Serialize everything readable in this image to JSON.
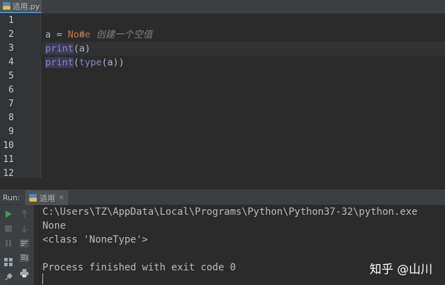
{
  "editor_tab": {
    "filename": "适用.py"
  },
  "editor": {
    "line_numbers": [
      "1",
      "2",
      "3",
      "4",
      "5",
      "6",
      "7",
      "8",
      "9",
      "10",
      "11",
      "12"
    ]
  },
  "code": {
    "line1_comment": "#  创建一个空值",
    "line2_var": "a = ",
    "line2_none": "None",
    "line3_print": "print",
    "line3_rest": "(a)",
    "line4_print": "print",
    "line4_open": "(",
    "line4_type": "type",
    "line4_rest": "(a))"
  },
  "run": {
    "label": "Run:",
    "tab_label": "适用",
    "tab_close": "×"
  },
  "console": {
    "lines": [
      "C:\\Users\\TZ\\AppData\\Local\\Programs\\Python\\Python37-32\\python.exe",
      "None",
      "<class 'NoneType'>",
      "",
      "Process finished with exit code 0"
    ]
  },
  "watermark": "知乎 @山川",
  "colors": {
    "background": "#2b2b2b",
    "keyword": "#cc7832",
    "builtin": "#8888c6",
    "comment": "#808080",
    "text": "#a9b7c6",
    "run_green": "#499c54"
  },
  "icons": {
    "file_tab": "python-file-icon",
    "run_tab": "python-file-icon",
    "toolbar": [
      "rerun-icon",
      "stop-icon",
      "pause-icon",
      "layout-icon",
      "pin-icon",
      "up-arrow-icon",
      "down-arrow-icon",
      "soft-wrap-icon",
      "scroll-to-end-icon",
      "print-icon"
    ]
  }
}
